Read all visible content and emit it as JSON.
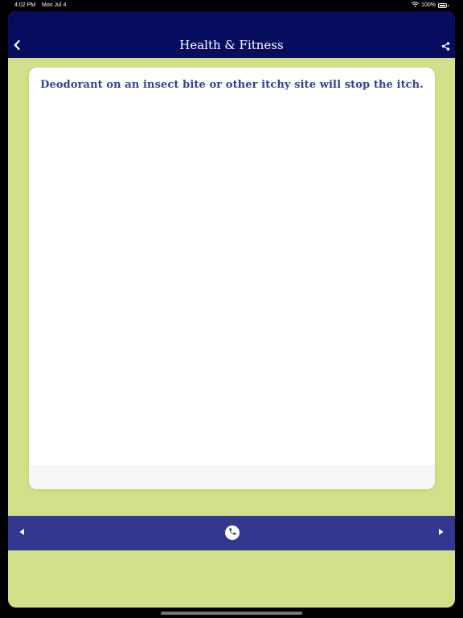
{
  "status_bar": {
    "time": "4:02 PM",
    "date": "Mon Jul 4",
    "battery": "100%",
    "icons": [
      "wifi-icon",
      "battery-icon"
    ]
  },
  "nav": {
    "title": "Health & Fitness",
    "back_icon": "chevron-left-icon",
    "share_icon": "share-icon"
  },
  "card": {
    "text": "Deodorant on an insect bite or other itchy site will stop the itch."
  },
  "bottom_bar": {
    "prev_icon": "triangle-left-icon",
    "phone_icon": "phone-icon",
    "next_icon": "triangle-right-icon"
  },
  "colors": {
    "nav_background": "#080c5e",
    "app_background": "#d2e189",
    "card_text": "#35409a",
    "bottom_bar": "#32378f"
  }
}
